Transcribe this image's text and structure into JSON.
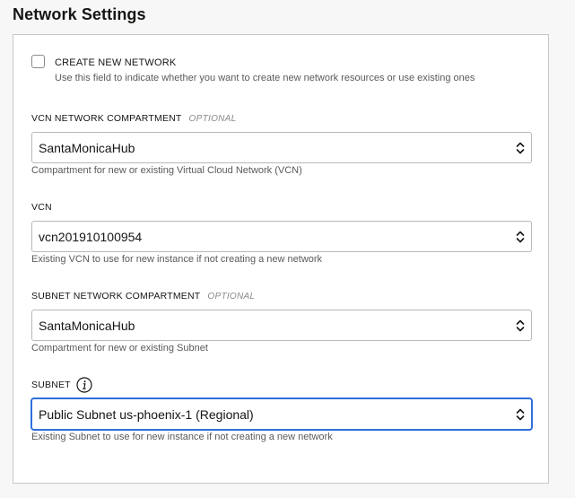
{
  "section": {
    "title": "Network Settings"
  },
  "create_network": {
    "label": "CREATE NEW NETWORK",
    "help": "Use this field to indicate whether you want to create new network resources or use existing ones",
    "checked": false
  },
  "vcn_compartment": {
    "label": "VCN NETWORK COMPARTMENT",
    "optional": "OPTIONAL",
    "value": "SantaMonicaHub",
    "help": "Compartment for new or existing Virtual Cloud Network (VCN)"
  },
  "vcn": {
    "label": "VCN",
    "value": "vcn201910100954",
    "help": "Existing VCN to use for new instance if not creating a new network"
  },
  "subnet_compartment": {
    "label": "SUBNET NETWORK COMPARTMENT",
    "optional": "OPTIONAL",
    "value": "SantaMonicaHub",
    "help": "Compartment for new or existing Subnet"
  },
  "subnet": {
    "label": "SUBNET",
    "value": "Public Subnet us-phoenix-1 (Regional)",
    "help": "Existing Subnet to use for new instance if not creating a new network"
  },
  "icons": {
    "select_arrows": "chevron-up-down-icon",
    "info": "info-icon"
  },
  "colors": {
    "focus_border": "#2f6fdb",
    "panel_border": "#c8c8c8"
  }
}
